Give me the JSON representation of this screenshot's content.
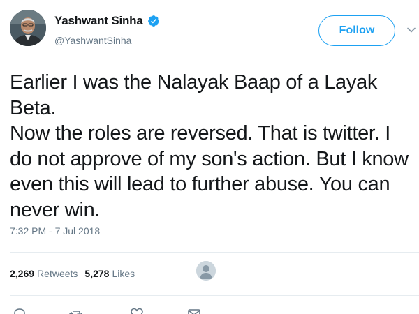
{
  "author": {
    "name": "Yashwant Sinha",
    "handle": "@YashwantSinha",
    "verified": true
  },
  "follow_button": {
    "label": "Follow"
  },
  "tweet": {
    "text": "Earlier I was the Nalayak Baap of a Layak Beta.\nNow the roles are reversed. That is twitter. I\ndo not approve of my son's action. But I know\neven this will lead to further abuse. You can\nnever win.",
    "timestamp": "7:32 PM - 7 Jul 2018"
  },
  "stats": {
    "retweets_count": "2,269",
    "retweets_label": "Retweets",
    "likes_count": "5,278",
    "likes_label": "Likes"
  },
  "colors": {
    "accent": "#1da1f2",
    "secondary_text": "#657786",
    "primary_text": "#14171a",
    "divider": "#e6ecf0"
  },
  "icons": {
    "verified": "verified-badge-icon",
    "more": "chevron-down-icon",
    "reply": "reply-icon",
    "retweet": "retweet-icon",
    "like": "heart-icon",
    "dm": "direct-message-icon"
  }
}
